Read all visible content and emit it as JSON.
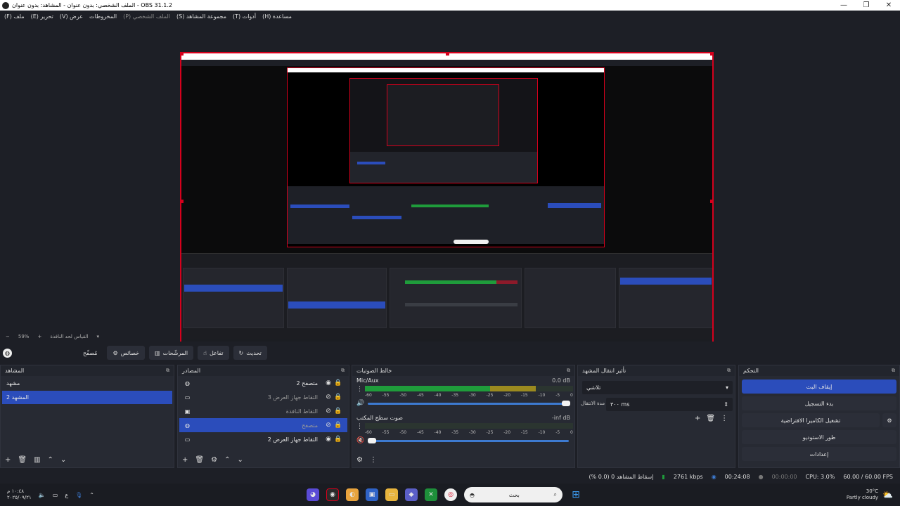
{
  "window": {
    "title": "الملف الشخصي: بدون عنوان - المشاهد: بدون عنوان - OBS 31.1.2",
    "minimize": "—",
    "maximize": "❐",
    "close": "✕"
  },
  "menu": [
    "(F) ملف",
    "(E) تحرير",
    "(V) عرض",
    "المخروطات",
    "(P) الملف الشخصي",
    "(S) مجموعة المشاهد",
    "(T) أدوات",
    "(H) مساعدة"
  ],
  "preview": {
    "zoom": "59%",
    "zoom_label": "القياس لحد النافذة"
  },
  "toolbar": {
    "filter_label": "مُصفّح",
    "properties_label": "خصائص",
    "filters_label": "المرشّحات",
    "interact_label": "تفاعل",
    "refresh_label": "تحديث"
  },
  "scenes": {
    "title": "المشاهد",
    "items": [
      {
        "label": "مشهد",
        "selected": false
      },
      {
        "label": "المشهد 2",
        "selected": true
      }
    ]
  },
  "sources": {
    "title": "المصادر",
    "items": [
      {
        "label": "متصفح 2",
        "icon": "globe-icon",
        "selected": false,
        "dim": false
      },
      {
        "label": "التقاط جهاز العرض 3",
        "icon": "monitor-icon",
        "selected": false,
        "dim": true
      },
      {
        "label": "التقاط النافذة",
        "icon": "window-icon",
        "selected": false,
        "dim": true
      },
      {
        "label": "متصفح",
        "icon": "globe-icon",
        "selected": true,
        "dim": true
      },
      {
        "label": "التقاط جهاز العرض 2",
        "icon": "monitor-icon",
        "selected": false,
        "dim": false
      }
    ]
  },
  "mixer": {
    "title": "خالط الصوتيات",
    "ticks": [
      "-60",
      "-55",
      "-50",
      "-45",
      "-40",
      "-35",
      "-30",
      "-25",
      "-20",
      "-15",
      "-10",
      "-5",
      "0"
    ],
    "tracks": [
      {
        "name": "Mic/Aux",
        "db": "0.0 dB",
        "level": 0.82,
        "volume": 1.0
      },
      {
        "name": "صوت سطح المكتب",
        "db": "-inf dB",
        "level": 0.0,
        "volume": 0.0
      }
    ]
  },
  "transitions": {
    "title": "تأثير انتقال المشهد",
    "selected": "تلاشي",
    "duration_label": "مدة الانتقال",
    "duration": "٣٠٠ ms"
  },
  "controls": {
    "title": "التحكم",
    "stop_stream": "إيقاف البث",
    "start_record": "بدء التسجيل",
    "virtual_cam": "تشغيل الكاميرا الافتراضية",
    "studio_mode": "طور الاستوديو",
    "settings": "إعدادات"
  },
  "status": {
    "dropped": "إسقاط المشاهد 0 (0.0 %)",
    "bitrate": "2761 kbps",
    "stream_time": "00:24:08",
    "record_time": "00:00:00",
    "cpu": "CPU: 3.0%",
    "fps": "60.00 / 60.00 FPS"
  },
  "taskbar": {
    "time": "١٠:٤٨ م",
    "date": "٢٠٢٥/٠٩/٢١",
    "lang": "ع",
    "search_placeholder": "بحث",
    "weather_temp": "30°C",
    "weather_desc": "Partly cloudy"
  },
  "colors": {
    "accent": "#2b4dbb",
    "selection_border": "#d6001c",
    "meter_green": "#1f9c3b",
    "meter_yellow": "#9b8a1f",
    "meter_red": "#8d1a2a"
  }
}
